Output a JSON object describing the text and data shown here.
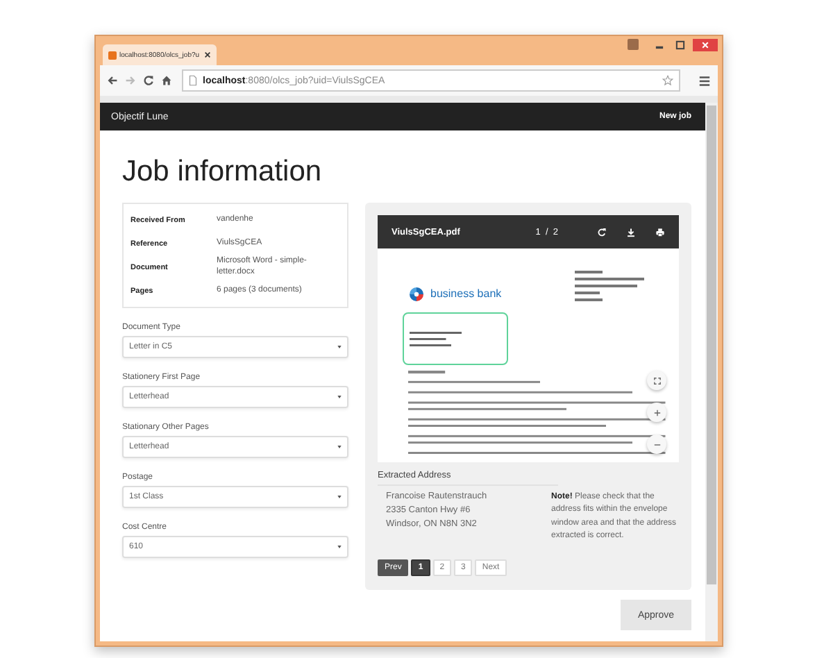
{
  "browser": {
    "tab_title": "localhost:8080/olcs_job?u",
    "url": "**localhost**:8080/olcs_job?uid=ViulsSgCEA"
  },
  "navbar": {
    "brand": "Objectif Lune",
    "link": "New job"
  },
  "heading": "Job information",
  "info": [
    {
      "label": "Received From",
      "value": "vandenhe"
    },
    {
      "label": "Reference",
      "value": "ViulsSgCEA"
    },
    {
      "label": "Document",
      "value": "Microsoft Word - simple-letter.docx"
    },
    {
      "label": "Pages",
      "value": "6 pages (3 documents)"
    }
  ],
  "fields": [
    {
      "label": "Document Type",
      "value": "Letter in C5"
    },
    {
      "label": "Stationery First Page",
      "value": "Letterhead"
    },
    {
      "label": "Stationary Other Pages",
      "value": "Letterhead"
    },
    {
      "label": "Postage",
      "value": "1st Class"
    },
    {
      "label": "Cost Centre",
      "value": "610"
    }
  ],
  "viewer": {
    "filename": "ViulsSgCEA.pdf",
    "page": "1  /  2",
    "logo_text": "business bank"
  },
  "extracted": {
    "label": "Extracted Address",
    "lines": [
      "Francoise Rautenstrauch",
      "2335 Canton Hwy #6",
      "Windsor, ON N8N 3N2"
    ],
    "note": "**Note!** Please check that the address fits within the envelope window area and that the address extracted is correct."
  },
  "pagination": [
    {
      "label": "Prev",
      "selected": false,
      "disabled": true
    },
    {
      "label": "1",
      "selected": true,
      "disabled": false
    },
    {
      "label": "2",
      "selected": false,
      "disabled": false
    },
    {
      "label": "3",
      "selected": false,
      "disabled": false
    },
    {
      "label": "Next",
      "selected": false,
      "disabled": false
    }
  ],
  "approve": "Approve"
}
